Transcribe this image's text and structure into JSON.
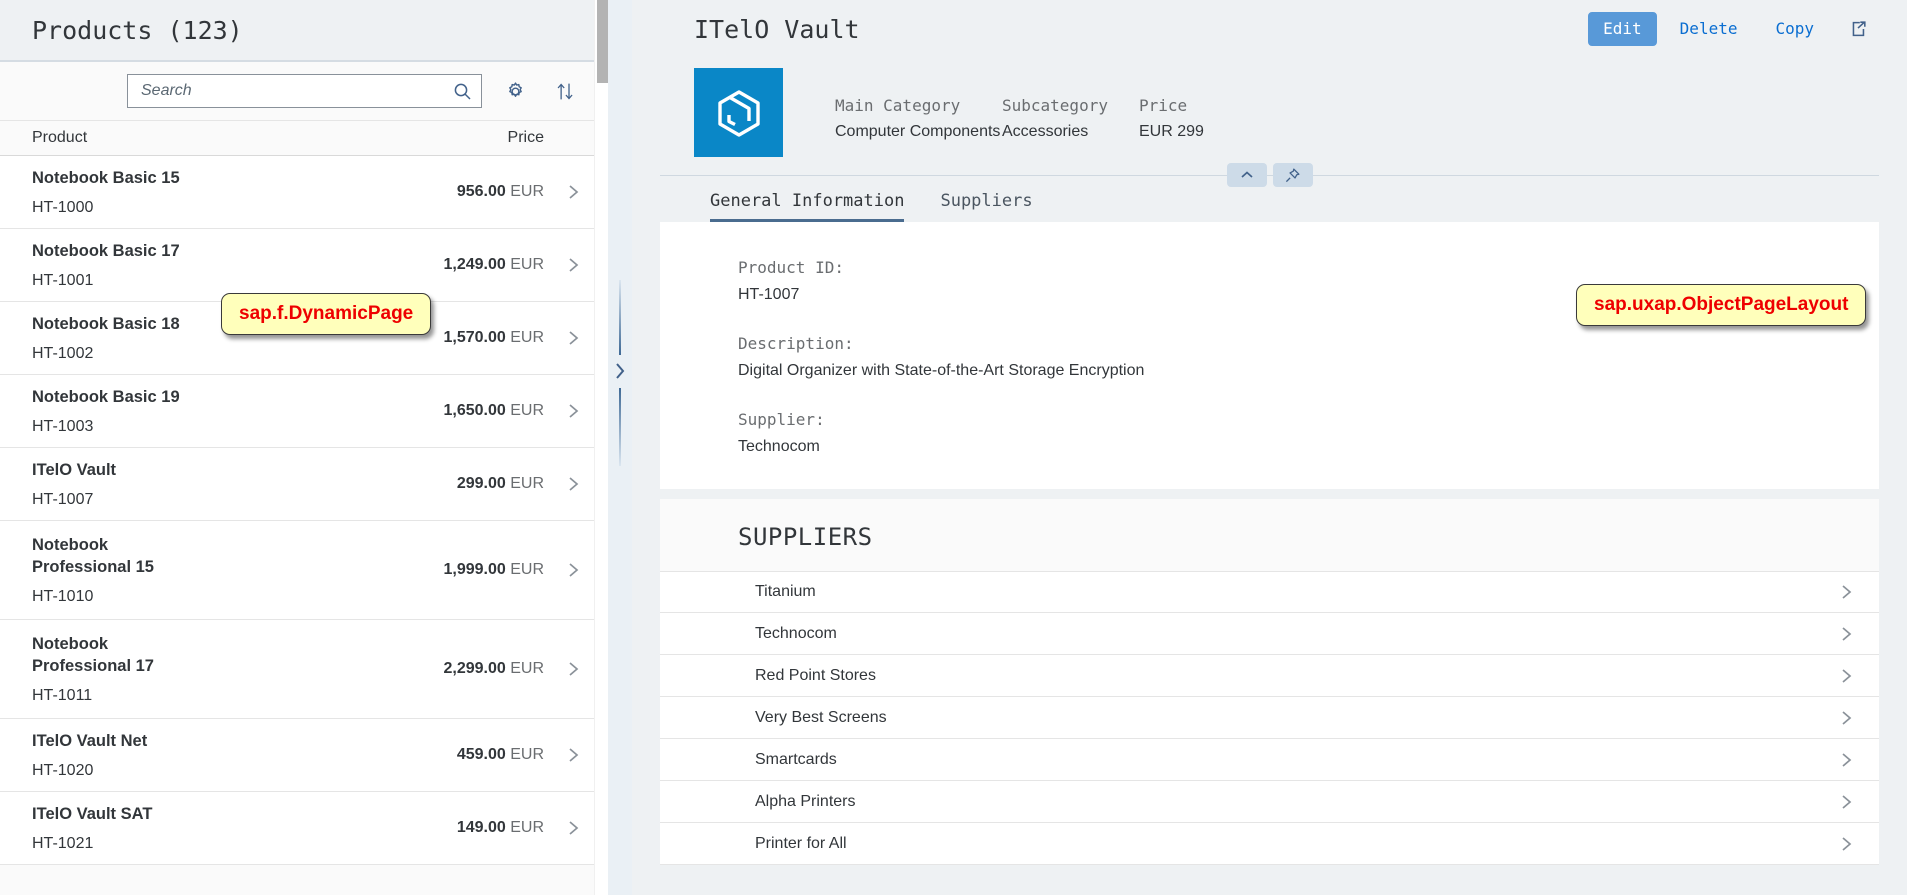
{
  "left_panel": {
    "title": "Products (123)",
    "search": {
      "placeholder": "Search",
      "value": ""
    },
    "icons": {
      "search": "search-icon",
      "settings": "gear-icon",
      "sort": "sort-icon"
    },
    "table_headers": {
      "product": "Product",
      "price": "Price"
    },
    "rows": [
      {
        "name": "Notebook Basic 15",
        "id": "HT-1000",
        "price": "956.00",
        "currency": "EUR"
      },
      {
        "name": "Notebook Basic 17",
        "id": "HT-1001",
        "price": "1,249.00",
        "currency": "EUR"
      },
      {
        "name": "Notebook Basic 18",
        "id": "HT-1002",
        "price": "1,570.00",
        "currency": "EUR"
      },
      {
        "name": "Notebook Basic 19",
        "id": "HT-1003",
        "price": "1,650.00",
        "currency": "EUR"
      },
      {
        "name": "ITelO Vault",
        "id": "HT-1007",
        "price": "299.00",
        "currency": "EUR"
      },
      {
        "name": "Notebook Professional 15",
        "id": "HT-1010",
        "price": "1,999.00",
        "currency": "EUR"
      },
      {
        "name": "Notebook Professional 17",
        "id": "HT-1011",
        "price": "2,299.00",
        "currency": "EUR"
      },
      {
        "name": "ITelO Vault Net",
        "id": "HT-1020",
        "price": "459.00",
        "currency": "EUR"
      },
      {
        "name": "ITelO Vault SAT",
        "id": "HT-1021",
        "price": "149.00",
        "currency": "EUR"
      }
    ]
  },
  "right_panel": {
    "title": "ITelO Vault",
    "actions": {
      "edit": "Edit",
      "delete": "Delete",
      "copy": "Copy",
      "share_icon": "share-icon"
    },
    "avatar_icon": "product-cube-icon",
    "facts": [
      {
        "label": "Main Category",
        "value": "Computer Components"
      },
      {
        "label": "Subcategory",
        "value": "Accessories"
      },
      {
        "label": "Price",
        "value": "EUR 299"
      }
    ],
    "header_toggles": {
      "collapse_icon": "chevron-up-icon",
      "pin_icon": "pin-icon"
    },
    "tabs": [
      {
        "label": "General Information",
        "active": true
      },
      {
        "label": "Suppliers",
        "active": false
      }
    ],
    "general_information": [
      {
        "label": "Product ID:",
        "value": "HT-1007"
      },
      {
        "label": "Description:",
        "value": "Digital Organizer with State-of-the-Art Storage Encryption"
      },
      {
        "label": "Supplier:",
        "value": "Technocom"
      }
    ],
    "suppliers_section": {
      "title": "SUPPLIERS",
      "items": [
        "Titanium",
        "Technocom",
        "Red Point Stores",
        "Very Best Screens",
        "Smartcards",
        "Alpha Printers",
        "Printer for All"
      ]
    }
  },
  "splitter": {
    "expand_icon": "chevron-right-icon"
  },
  "annotations": [
    {
      "id": "dynamicpage",
      "text": "sap.f.DynamicPage"
    },
    {
      "id": "objectpage",
      "text": "sap.uxap.ObjectPageLayout"
    }
  ],
  "colors": {
    "accent": "#0a6ed1",
    "emphasized_button": "#5899d8",
    "avatar_tile": "#0a87c7",
    "header_bg": "#eef1f3",
    "annotation_bg": "#ffffbb",
    "annotation_text": "#ee0000"
  }
}
